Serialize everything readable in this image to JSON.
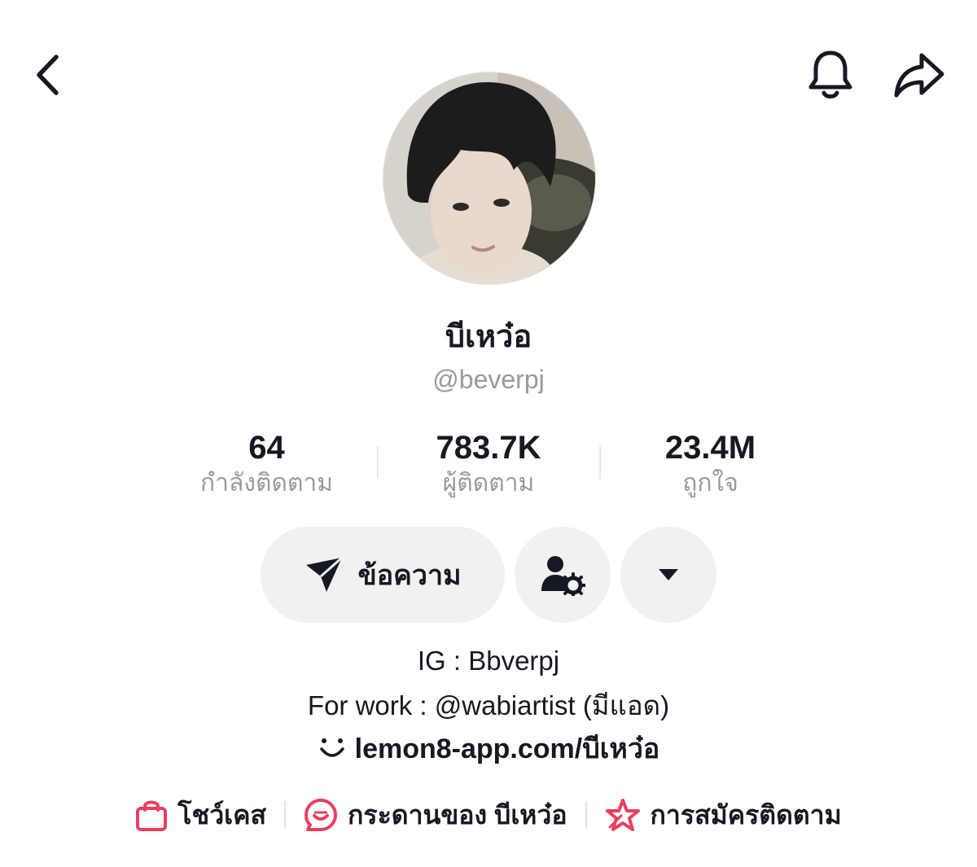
{
  "header": {
    "back_icon": "chevron-left-icon",
    "notification_icon": "bell-icon",
    "share_icon": "share-arrow-icon"
  },
  "profile": {
    "display_name": "บีเหว๋อ",
    "username": "@beverpj"
  },
  "stats": [
    {
      "value": "64",
      "label": "กำลังติดตาม"
    },
    {
      "value": "783.7K",
      "label": "ผู้ติดตาม"
    },
    {
      "value": "23.4M",
      "label": "ถูกใจ"
    }
  ],
  "actions": {
    "message_label": "ข้อความ",
    "message_icon": "send-icon",
    "friend_icon": "user-settings-icon",
    "more_icon": "caret-down-icon"
  },
  "bio": {
    "line1": "IG : Bbverpj",
    "line2": "For work : @wabiartist (มีแอด)",
    "link_icon": "smile-link-icon",
    "link": "lemon8-app.com/บีเหว๋อ"
  },
  "tabs": [
    {
      "label": "โชว์เคส",
      "icon": "shopping-bag-icon"
    },
    {
      "label": "กระดานของ บีเหว๋อ",
      "icon": "chat-bubble-icon"
    },
    {
      "label": "การสมัครติดตาม",
      "icon": "star-icon"
    }
  ],
  "colors": {
    "accent_pink": "#E8405F",
    "text_primary": "#161823",
    "text_secondary": "#9A9A9E",
    "button_bg": "#F1F1F2"
  }
}
